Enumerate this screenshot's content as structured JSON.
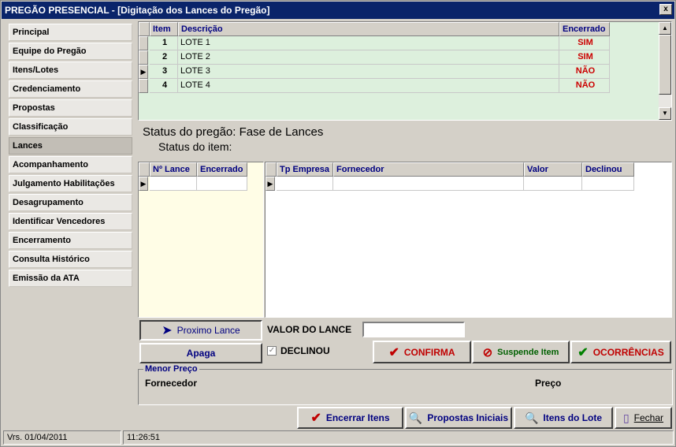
{
  "window": {
    "title": "PREGÃO PRESENCIAL - [Digitação dos Lances do Pregão]",
    "close": "x"
  },
  "sidebar": {
    "items": [
      {
        "label": "Principal"
      },
      {
        "label": "Equipe do Pregão"
      },
      {
        "label": "Itens/Lotes"
      },
      {
        "label": "Credenciamento"
      },
      {
        "label": "Propostas"
      },
      {
        "label": "Classificação"
      },
      {
        "label": "Lances"
      },
      {
        "label": "Acompanhamento"
      },
      {
        "label": "Julgamento Habilitações"
      },
      {
        "label": "Desagrupamento"
      },
      {
        "label": "Identificar Vencedores"
      },
      {
        "label": "Encerramento"
      },
      {
        "label": "Consulta Histórico"
      },
      {
        "label": "Emissão da ATA"
      }
    ],
    "active": "Lances"
  },
  "items_grid": {
    "headers": {
      "item": "Item",
      "descricao": "Descrição",
      "encerrado": "Encerrado"
    },
    "rows": [
      {
        "item": "1",
        "descricao": "LOTE 1",
        "encerrado": "SIM"
      },
      {
        "item": "2",
        "descricao": "LOTE 2",
        "encerrado": "SIM"
      },
      {
        "item": "3",
        "descricao": "LOTE 3",
        "encerrado": "NÃO"
      },
      {
        "item": "4",
        "descricao": "LOTE 4",
        "encerrado": "NÃO"
      }
    ],
    "current_row": 2
  },
  "status": {
    "pregao_label": "Status do pregão:",
    "pregao_value": "Fase de Lances",
    "item_label": "Status do item:"
  },
  "lances_grid": {
    "headers": {
      "numero": "Nº Lance",
      "encerrado": "Encerrado"
    }
  },
  "fornecedores_grid": {
    "headers": {
      "tp_empresa": "Tp Empresa",
      "fornecedor": "Fornecedor",
      "valor": "Valor",
      "declinou": "Declinou"
    }
  },
  "actions": {
    "proximo_lance": "Proximo Lance",
    "apaga": "Apaga",
    "valor_lance_label": "VALOR DO LANCE",
    "valor_lance_value": "",
    "declinou_label": "DECLINOU",
    "declinou_checked": true,
    "confirma": "CONFIRMA",
    "suspende": "Suspende Item",
    "ocorrencias": "OCORRÊNCIAS"
  },
  "menor_preco": {
    "title": "Menor Preço",
    "fornecedor_label": "Fornecedor",
    "preco_label": "Preço"
  },
  "bottom_buttons": {
    "encerrar": "Encerrar Itens",
    "propostas": "Propostas Iniciais",
    "itens_lote": "Itens do Lote",
    "fechar": "Fechar"
  },
  "statusbar": {
    "version": "Vrs. 01/04/2011",
    "time": "11:26:51"
  },
  "colors": {
    "titlebar": "#0a246a",
    "grid_bg": "#ddf0dd",
    "lances_bg": "#fffde6",
    "sim": "#cc0000",
    "header_text": "#000080"
  }
}
